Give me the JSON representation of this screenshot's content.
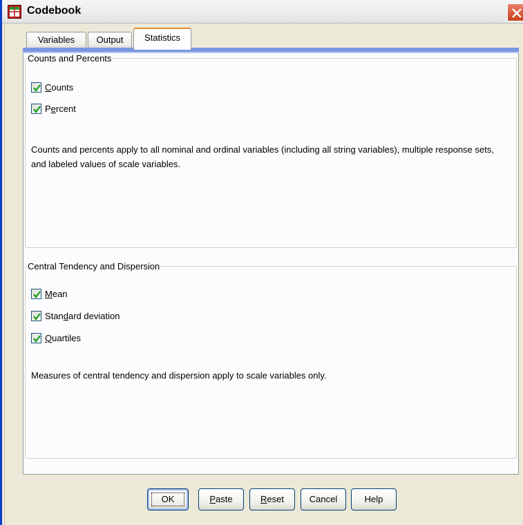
{
  "window": {
    "title": "Codebook",
    "close_label": "×"
  },
  "tabs": [
    {
      "label": "Variables",
      "active": false
    },
    {
      "label": "Output",
      "active": false
    },
    {
      "label": "Statistics",
      "active": true
    }
  ],
  "counts_percents": {
    "legend": "Counts and Percents",
    "checkboxes": [
      {
        "pre": "",
        "mnemonic": "C",
        "post": "ounts",
        "checked": true
      },
      {
        "pre": "P",
        "mnemonic": "e",
        "post": "rcent",
        "checked": true
      }
    ],
    "description": "Counts and percents apply to all nominal and ordinal variables (including all string variables), multiple response sets, and labeled values of scale variables."
  },
  "central_tendency": {
    "legend": "Central Tendency and Dispersion",
    "checkboxes": [
      {
        "pre": "",
        "mnemonic": "M",
        "post": "ean",
        "checked": true
      },
      {
        "pre": "Stan",
        "mnemonic": "d",
        "post": "ard deviation",
        "checked": true
      },
      {
        "pre": "",
        "mnemonic": "Q",
        "post": "uartiles",
        "checked": true
      }
    ],
    "description": "Measures of central tendency and dispersion apply to scale variables only."
  },
  "buttons": [
    {
      "pre": "",
      "mnemonic": "",
      "post": "OK",
      "default": true
    },
    {
      "pre": "",
      "mnemonic": "P",
      "post": "aste",
      "default": false
    },
    {
      "pre": "",
      "mnemonic": "R",
      "post": "eset",
      "default": false
    },
    {
      "pre": "Cancel",
      "mnemonic": "",
      "post": "",
      "default": false
    },
    {
      "pre": "Help",
      "mnemonic": "",
      "post": "",
      "default": false
    }
  ],
  "colors": {
    "dialog_bg": "#ece9d8",
    "panel_bg": "#fcfcfe",
    "tab_accent": "#e68b2c",
    "tab_underline": "#7a96df",
    "close_button": "#c8401a",
    "check_mark": "#21a121"
  }
}
